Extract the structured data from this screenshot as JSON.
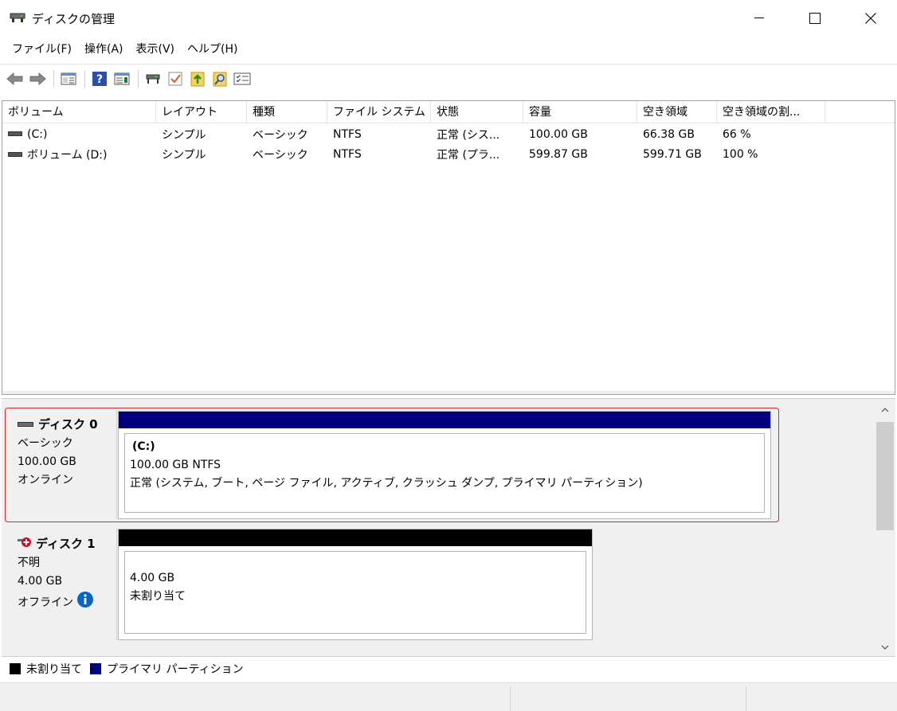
{
  "window": {
    "title": "ディスクの管理",
    "icon": "disk-management-icon"
  },
  "menu": [
    {
      "label": "ファイル(F)"
    },
    {
      "label": "操作(A)"
    },
    {
      "label": "表示(V)"
    },
    {
      "label": "ヘルプ(H)"
    }
  ],
  "toolbar": {
    "buttons": [
      "back-arrow-icon",
      "forward-arrow-icon",
      "console-tree-icon",
      "help-icon",
      "action-pane-icon",
      "connect-icon",
      "properties-check-icon",
      "export-icon",
      "search-icon",
      "list-icon"
    ]
  },
  "volume_list": {
    "columns": [
      "ボリューム",
      "レイアウト",
      "種類",
      "ファイル システム",
      "状態",
      "容量",
      "空き領域",
      "空き領域の割..."
    ],
    "rows": [
      [
        "(C:)",
        "シンプル",
        "ベーシック",
        "NTFS",
        "正常 (シス...",
        "100.00 GB",
        "66.38 GB",
        "66 %"
      ],
      [
        "ボリューム (D:)",
        "シンプル",
        "ベーシック",
        "NTFS",
        "正常 (プラ...",
        "599.87 GB",
        "599.71 GB",
        "100 %"
      ]
    ]
  },
  "disks": [
    {
      "name": "ディスク 0",
      "type": "ベーシック",
      "size": "100.00 GB",
      "status": "オンライン",
      "partition": {
        "title": "(C:)",
        "size_fs": "100.00 GB NTFS",
        "state": "正常 (システム, ブート, ページ ファイル, アクティブ, クラッシュ ダンプ, プライマリ パーティション)",
        "bar_color": "#00007f"
      }
    },
    {
      "name": "ディスク 1",
      "type": "不明",
      "size": "4.00 GB",
      "status": "オフライン",
      "partition": {
        "size": "4.00 GB",
        "state": "未割り当て",
        "bar_color": "#000000"
      }
    }
  ],
  "legend": [
    {
      "label": "未割り当て",
      "color": "#000000"
    },
    {
      "label": "プライマリ パーティション",
      "color": "#00007f"
    }
  ],
  "colors": {
    "selection": "#e0242b",
    "primary_partition": "#00007f",
    "unallocated": "#000000",
    "info": "#0a64c8"
  }
}
